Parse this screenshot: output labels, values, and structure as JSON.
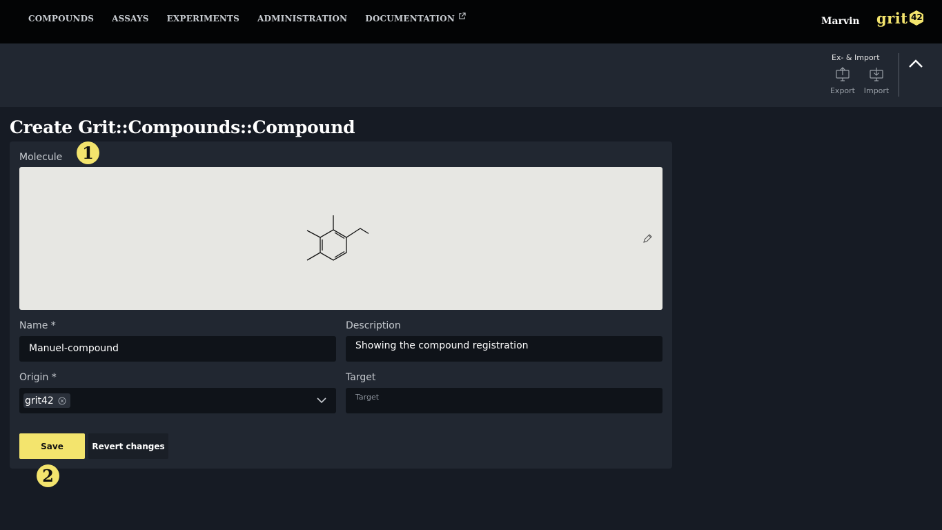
{
  "nav": {
    "items": [
      {
        "label": "COMPOUNDS"
      },
      {
        "label": "ASSAYS"
      },
      {
        "label": "EXPERIMENTS"
      },
      {
        "label": "ADMINISTRATION"
      },
      {
        "label": "DOCUMENTATION",
        "icon": "external-link-icon"
      }
    ],
    "user": "Marvin",
    "logo_text": "grit",
    "logo_number": "42"
  },
  "toolbar": {
    "group_title": "Ex- & Import",
    "export_label": "Export",
    "import_label": "Import",
    "collapse_icon": "chevron-up-icon"
  },
  "page": {
    "title": "Create Grit::Compounds::Compound"
  },
  "form": {
    "molecule_label": "Molecule",
    "edit_icon": "pencil-icon",
    "name_label": "Name *",
    "name_value": "Manuel-compound",
    "description_label": "Description",
    "description_value": "Showing the compound registration",
    "origin_label": "Origin *",
    "origin_value": "grit42",
    "target_label": "Target",
    "target_placeholder": "Target",
    "save_label": "Save",
    "revert_label": "Revert changes"
  },
  "badges": {
    "step1": "1",
    "step2": "2"
  },
  "colors": {
    "accent": "#f3e46d",
    "nav_bg": "#030405",
    "page_bg": "#161b24",
    "panel_bg": "#212731",
    "input_bg": "#0f1319",
    "molecule_bg": "#e7e7e3"
  }
}
